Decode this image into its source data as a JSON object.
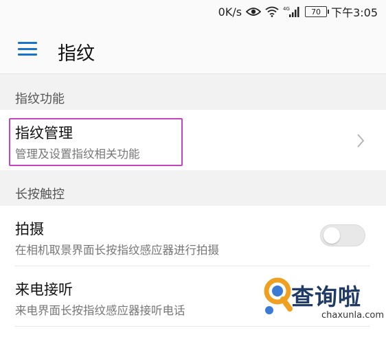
{
  "status_bar": {
    "network_speed": "0K/s",
    "eye_icon": "eye-icon",
    "wifi_icon": "wifi-icon",
    "signal_label": "4G",
    "battery": "70",
    "time": "下午3:05"
  },
  "app_bar": {
    "title": "指纹"
  },
  "sections": {
    "fingerprint_function": {
      "header": "指纹功能",
      "item": {
        "title": "指纹管理",
        "subtitle": "管理及设置指纹相关功能"
      }
    },
    "long_press": {
      "header": "长按触控",
      "items": [
        {
          "title": "拍摄",
          "subtitle": "在相机取景界面长按指纹感应器进行拍摄",
          "toggle_on": false
        },
        {
          "title": "来电接听",
          "subtitle": "来电界面长按指纹感应器接听电话"
        }
      ]
    }
  },
  "watermark": {
    "text": "查询啦",
    "url": "chaxunla.com"
  },
  "colors": {
    "accent": "#1a73c8",
    "highlight": "#c445c4",
    "background": "#f2f2f2"
  }
}
